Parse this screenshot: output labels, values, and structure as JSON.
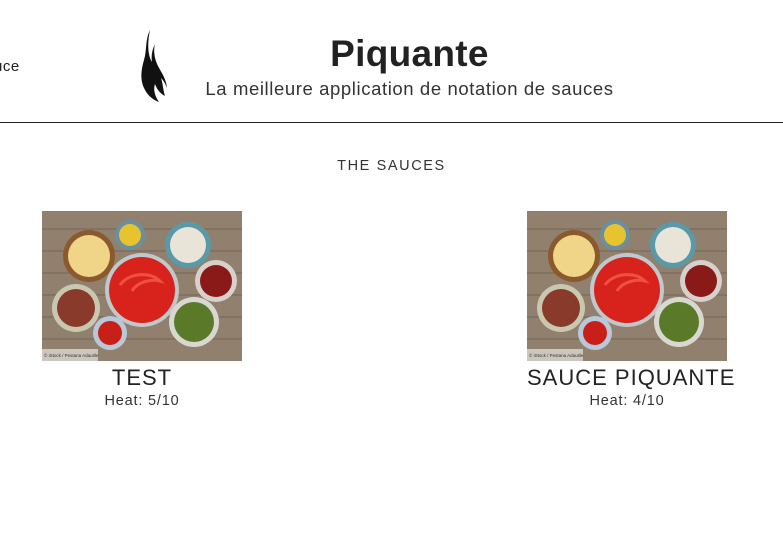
{
  "header": {
    "nav_label": "uce",
    "logo_icon": "flame-icon",
    "title": "Piquante",
    "subtitle": "La meilleure application de notation de sauces"
  },
  "main": {
    "section_title": "THE SAUCES",
    "sauces": [
      {
        "name": "TEST",
        "heat": "Heat: 5/10",
        "credit": "© iStock / Pestana Adautile"
      },
      {
        "name": "SAUCE PIQUANTE",
        "heat": "Heat: 4/10",
        "credit": "© iStock / Pestana Adautile"
      }
    ]
  }
}
